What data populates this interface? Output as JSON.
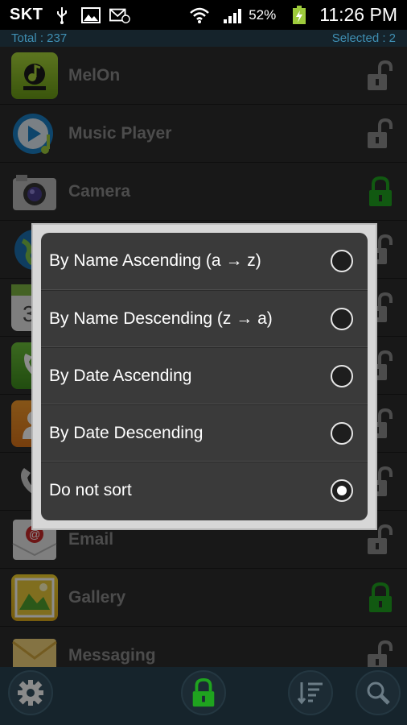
{
  "status_bar": {
    "carrier": "SKT",
    "icons": [
      "usb-icon",
      "image-icon",
      "sync-mail-icon",
      "wifi-icon",
      "signal-icon",
      "battery-icon"
    ],
    "battery": "52%",
    "time": "11:26 PM"
  },
  "info": {
    "total": "Total : 237",
    "selected": "Selected : 2"
  },
  "apps": [
    {
      "name": "MelOn",
      "icon": "melon-icon",
      "locked": false
    },
    {
      "name": "Music Player",
      "icon": "music-player-icon",
      "locked": false
    },
    {
      "name": "Camera",
      "icon": "camera-icon",
      "locked": true
    },
    {
      "name": "",
      "icon": "internet-icon",
      "locked": false
    },
    {
      "name": "",
      "icon": "calendar-icon",
      "locked": false
    },
    {
      "name": "",
      "icon": "phone-icon",
      "locked": false
    },
    {
      "name": "",
      "icon": "contacts-icon",
      "locked": false
    },
    {
      "name": "",
      "icon": "call-icon",
      "locked": false
    },
    {
      "name": "Email",
      "icon": "email-icon",
      "locked": false
    },
    {
      "name": "Gallery",
      "icon": "gallery-icon",
      "locked": true
    },
    {
      "name": "Messaging",
      "icon": "messaging-icon",
      "locked": false
    }
  ],
  "sort_dialog": {
    "options": [
      {
        "label": "By Name Ascending (a → z)",
        "selected": false
      },
      {
        "label": "By Name Descending (z → a)",
        "selected": false
      },
      {
        "label": "By Date Ascending",
        "selected": false
      },
      {
        "label": "By Date Descending",
        "selected": false
      },
      {
        "label": "Do not sort",
        "selected": true
      }
    ]
  },
  "toolbar": {
    "buttons": [
      "settings-icon",
      "lock-icon",
      "sort-icon",
      "search-icon"
    ]
  },
  "colors": {
    "lock_locked": "#1fa31f",
    "lock_unlocked": "#8a8a8a",
    "info_text": "#3f8fb3"
  }
}
